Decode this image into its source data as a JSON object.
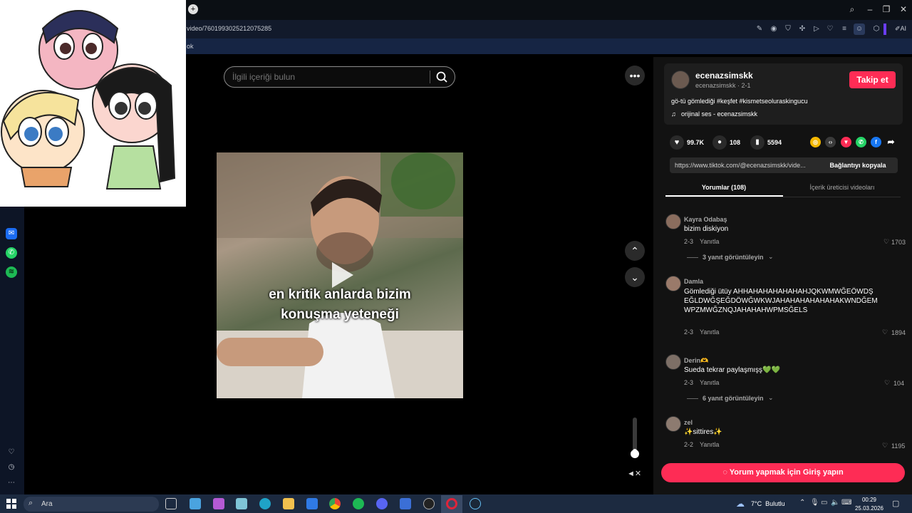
{
  "browser": {
    "url": "video/7601993025212075285",
    "bookmark": "ok",
    "ai_label": "AI"
  },
  "page": {
    "search_placeholder": "İlgili içeriği bulun",
    "caption_line1": "en kritik anlarda bizim",
    "caption_line2": "konuşma yeteneği"
  },
  "author": {
    "display_name": "ecenazsimskk",
    "handle_date": "ecenazsimskk · 2-1",
    "follow_label": "Takip et",
    "description": "gö-tü gömlediği #keşfet #kismetseoluraskingucu",
    "sound": "orijinal ses - ecenazsimskk"
  },
  "stats": {
    "likes": "99.7K",
    "comments": "108",
    "saves": "5594"
  },
  "link": {
    "url_text": "https://www.tiktok.com/@ecenazsimskk/vide...",
    "copy_label": "Bağlantıyı kopyala"
  },
  "tabs": [
    {
      "label": "Yorumlar (108)"
    },
    {
      "label": "İçerik üreticisi videoları"
    }
  ],
  "comments": [
    {
      "user": "Kayra Odabaş",
      "text": "bizim diskiyon",
      "date": "2-3",
      "reply": "Yanıtla",
      "likes": "1703",
      "more": "3 yanıt görüntüleyin"
    },
    {
      "user": "Damla",
      "text": "Gömlediği ütüy AHHAHAHAHAHAHAHJQKWMWĞEÖWDŞEĞLDWĞŞEĞDÖWĞWKWJAHAHAHAHAHAHAKWNDĞEMWPZMWĞZNQJAHAHAHWPMSĞELS",
      "date": "2-3",
      "reply": "Yanıtla",
      "likes": "1894"
    },
    {
      "user": "Derin🫶",
      "text": "Sueda tekrar paylaşmışş💚💚",
      "date": "2-3",
      "reply": "Yanıtla",
      "likes": "104",
      "more": "6 yanıt görüntüleyin"
    },
    {
      "user": "zel",
      "text": "✨sittires✨",
      "date": "2-2",
      "reply": "Yanıtla",
      "likes": "1195"
    }
  ],
  "login_button": "Yorum yapmak için Giriş yapın",
  "taskbar": {
    "search": "Ara",
    "weather": "7°C  Bulutlu",
    "time": "00:29",
    "date": "25.03.2026"
  },
  "colors": {
    "brand_red": "#fe2c55",
    "panel_bg": "#121212",
    "taskbar_bg": "#1c2a40"
  }
}
